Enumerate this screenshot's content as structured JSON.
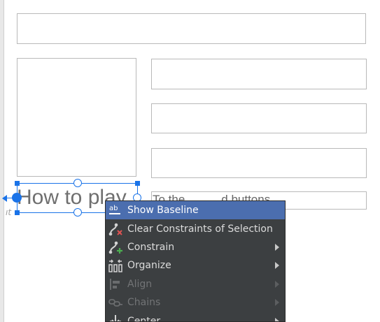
{
  "canvas": {
    "selected_text": "How to play",
    "baseline_marker": "ab",
    "partial_text": "To the...       ... ...d buttons."
  },
  "context_menu": {
    "items": [
      {
        "label": "Show Baseline",
        "icon": "baseline-icon",
        "state": "highlighted",
        "submenu": false
      },
      {
        "label": "Clear Constraints of Selection",
        "icon": "clear-constraints-icon",
        "state": "enabled",
        "submenu": false
      },
      {
        "label": "Constrain",
        "icon": "constrain-icon",
        "state": "enabled",
        "submenu": true
      },
      {
        "label": "Organize",
        "icon": "organize-icon",
        "state": "enabled",
        "submenu": true
      },
      {
        "label": "Align",
        "icon": "align-icon",
        "state": "disabled",
        "submenu": true
      },
      {
        "label": "Chains",
        "icon": "chains-icon",
        "state": "disabled",
        "submenu": true
      },
      {
        "label": "Center",
        "icon": "center-icon",
        "state": "enabled",
        "submenu": true
      }
    ]
  },
  "colors": {
    "selection": "#1a73e8",
    "menu_bg": "#3c3f41",
    "menu_highlight": "#4b6eaf"
  }
}
